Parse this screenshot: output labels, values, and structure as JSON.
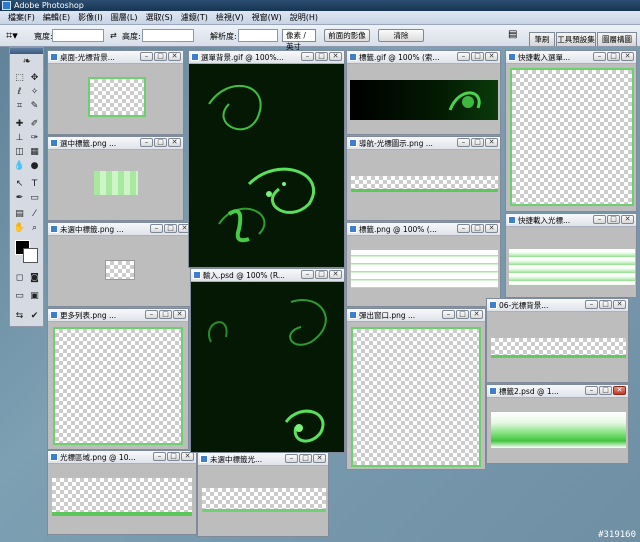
{
  "app": {
    "title": "Adobe Photoshop"
  },
  "menu": [
    "檔案(F)",
    "編輯(E)",
    "影像(I)",
    "圖層(L)",
    "選取(S)",
    "濾鏡(T)",
    "檢視(V)",
    "視窗(W)",
    "說明(H)"
  ],
  "options": {
    "width_label": "寬度:",
    "height_label": "高度:",
    "resolution_label": "解析度:",
    "unit_select": "像素 / 英寸",
    "front_image_button": "前面的影像",
    "clear_button": "清除",
    "palette_tabs": [
      "筆刷",
      "工具預設集",
      "圖層構圖"
    ]
  },
  "documents": [
    {
      "title": "桌面-光標背景..."
    },
    {
      "title": "選中標籤.png ..."
    },
    {
      "title": "未選中標籤.png ..."
    },
    {
      "title": "更多列表.png ..."
    },
    {
      "title": "光標區域.png @ 10..."
    },
    {
      "title": "選單背景.gif @ 100%..."
    },
    {
      "title": "輸入.psd @ 100% (R..."
    },
    {
      "title": "未選中標籤光..."
    },
    {
      "title": "標籤.gif @ 100% (索..."
    },
    {
      "title": "導航-光標圖示.png ..."
    },
    {
      "title": "標籤.png @ 100% (..."
    },
    {
      "title": "彈出窗口.png ..."
    },
    {
      "title": "快捷載入選單..."
    },
    {
      "title": "快捷載入光標..."
    },
    {
      "title": "06-光標背景..."
    },
    {
      "title": "標籤2.psd @ 1..."
    }
  ],
  "watermark": "#319160",
  "colors": {
    "accent_green": "#6cd06c",
    "foreground": "#000000",
    "background": "#ffffff"
  }
}
